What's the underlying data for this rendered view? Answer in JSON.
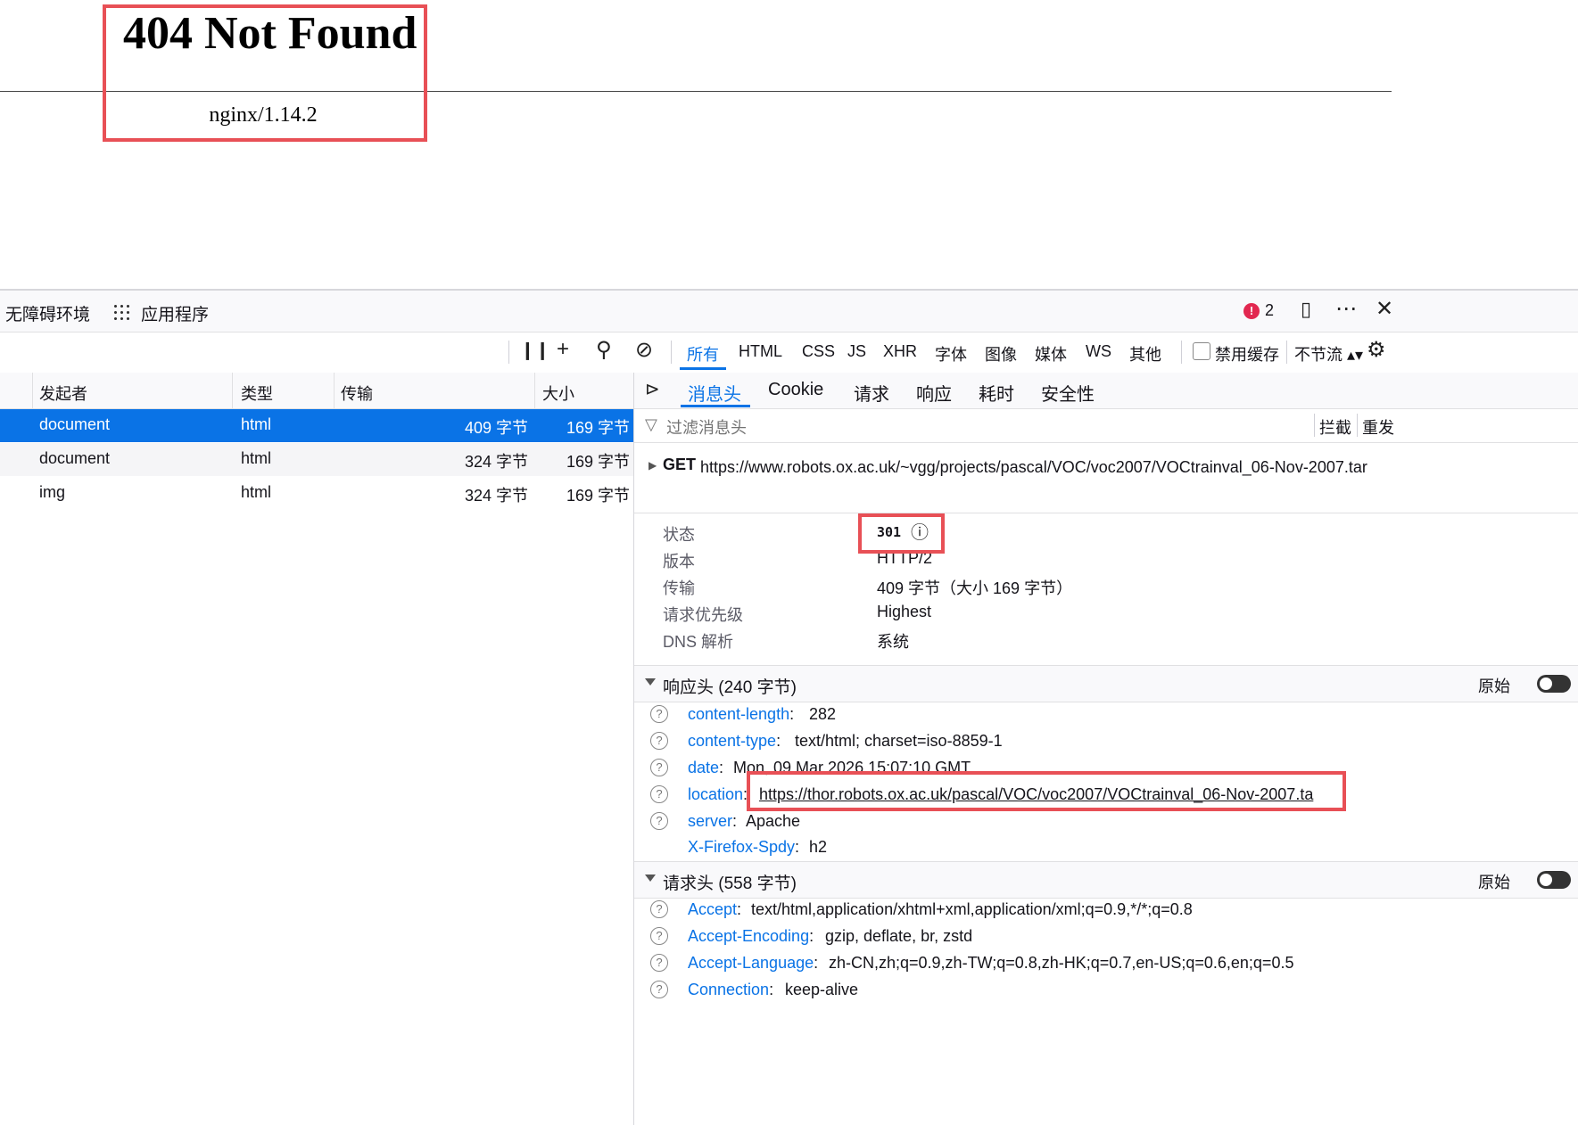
{
  "page": {
    "heading": "404 Not Found",
    "server": "nginx/1.14.2"
  },
  "devtools": {
    "top_tabs": [
      "无障碍环境",
      "应用程序"
    ],
    "error_count": "2",
    "toolbar": {
      "filters": [
        "所有",
        "HTML",
        "CSS",
        "JS",
        "XHR",
        "字体",
        "图像",
        "媒体",
        "WS",
        "其他"
      ],
      "disable_cache": "禁用缓存",
      "throttle": "不节流 ▴▾"
    },
    "list": {
      "headers": [
        "发起者",
        "类型",
        "传输",
        "大小"
      ],
      "rows": [
        {
          "initiator": "document",
          "type": "html",
          "transfer": "409 字节",
          "size": "169 字节"
        },
        {
          "initiator": "document",
          "type": "html",
          "transfer": "324 字节",
          "size": "169 字节"
        },
        {
          "initiator": "img",
          "type": "html",
          "transfer": "324 字节",
          "size": "169 字节"
        }
      ]
    },
    "detail": {
      "tabs": [
        "消息头",
        "Cookie",
        "请求",
        "响应",
        "耗时",
        "安全性"
      ],
      "filter_placeholder": "过滤消息头",
      "block": "拦截",
      "resend": "重发",
      "method": "GET",
      "url": "https://www.robots.ox.ac.uk/~vgg/projects/pascal/VOC/voc2007/VOCtrainval_06-Nov-2007.tar",
      "summary": [
        {
          "k": "状态",
          "v": "301"
        },
        {
          "k": "版本",
          "v": "HTTP/2"
        },
        {
          "k": "传输",
          "v": "409 字节（大小 169 字节）"
        },
        {
          "k": "请求优先级",
          "v": "Highest"
        },
        {
          "k": "DNS 解析",
          "v": "系统"
        }
      ],
      "response_headers_title": "响应头 (240 字节)",
      "request_headers_title": "请求头 (558 字节)",
      "raw_label": "原始",
      "response_headers": [
        {
          "k": "content-length",
          "v": "282"
        },
        {
          "k": "content-type",
          "v": "text/html; charset=iso-8859-1"
        },
        {
          "k": "date",
          "v": "Mon, 09 Mar 2026 15:07:10 GMT"
        },
        {
          "k": "location",
          "v": "https://thor.robots.ox.ac.uk/pascal/VOC/voc2007/VOCtrainval_06-Nov-2007.ta"
        },
        {
          "k": "server",
          "v": "Apache"
        },
        {
          "k": "X-Firefox-Spdy",
          "v": "h2"
        }
      ],
      "request_headers": [
        {
          "k": "Accept",
          "v": "text/html,application/xhtml+xml,application/xml;q=0.9,*/*;q=0.8"
        },
        {
          "k": "Accept-Encoding",
          "v": "gzip, deflate, br, zstd"
        },
        {
          "k": "Accept-Language",
          "v": "zh-CN,zh;q=0.9,zh-TW;q=0.8,zh-HK;q=0.7,en-US;q=0.6,en;q=0.5"
        },
        {
          "k": "Connection",
          "v": "keep-alive"
        }
      ]
    }
  }
}
